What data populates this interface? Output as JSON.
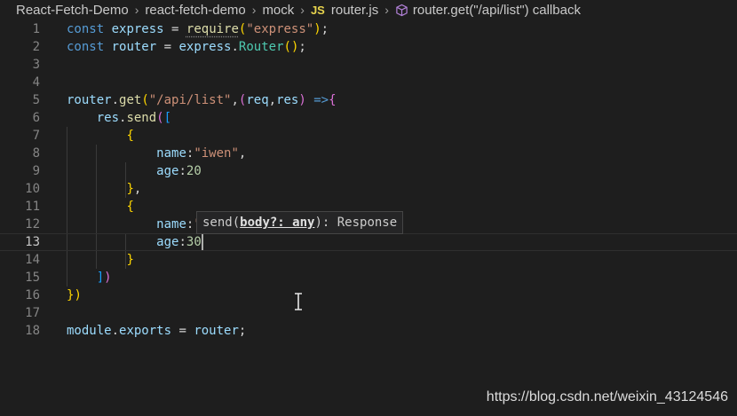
{
  "breadcrumbs": {
    "items": [
      "React-Fetch-Demo",
      "react-fetch-demo",
      "mock"
    ],
    "file_badge": "JS",
    "file_name": "router.js",
    "symbol": "router.get(\"/api/list\") callback"
  },
  "editor": {
    "active_line": 13,
    "line_numbers": [
      "1",
      "2",
      "3",
      "4",
      "5",
      "6",
      "7",
      "8",
      "9",
      "10",
      "11",
      "12",
      "13",
      "14",
      "15",
      "16",
      "17",
      "18"
    ],
    "lines": [
      [
        [
          "kw",
          "const"
        ],
        [
          "pun",
          " "
        ],
        [
          "var",
          "express"
        ],
        [
          "pun",
          " = "
        ],
        [
          "fn req",
          "require"
        ],
        [
          "br1",
          "("
        ],
        [
          "str",
          "\"express\""
        ],
        [
          "br1",
          ")"
        ],
        [
          "pun",
          ";"
        ]
      ],
      [
        [
          "kw",
          "const"
        ],
        [
          "pun",
          " "
        ],
        [
          "var",
          "router"
        ],
        [
          "pun",
          " = "
        ],
        [
          "var",
          "express"
        ],
        [
          "pun",
          "."
        ],
        [
          "cls",
          "Router"
        ],
        [
          "br1",
          "("
        ],
        [
          "br1",
          ")"
        ],
        [
          "pun",
          ";"
        ]
      ],
      [],
      [],
      [
        [
          "var",
          "router"
        ],
        [
          "pun",
          "."
        ],
        [
          "fn",
          "get"
        ],
        [
          "br1",
          "("
        ],
        [
          "str",
          "\"/api/list\""
        ],
        [
          "pun",
          ","
        ],
        [
          "br2",
          "("
        ],
        [
          "var",
          "req"
        ],
        [
          "pun",
          ","
        ],
        [
          "var",
          "res"
        ],
        [
          "br2",
          ")"
        ],
        [
          "pun",
          " "
        ],
        [
          "kw",
          "=>"
        ],
        [
          "br2",
          "{"
        ]
      ],
      [
        [
          "pun",
          "    "
        ],
        [
          "var",
          "res"
        ],
        [
          "pun",
          "."
        ],
        [
          "fn",
          "send"
        ],
        [
          "br2",
          "("
        ],
        [
          "br3",
          "["
        ]
      ],
      [
        [
          "pun",
          "        "
        ],
        [
          "br1",
          "{"
        ]
      ],
      [
        [
          "pun",
          "            "
        ],
        [
          "var",
          "name"
        ],
        [
          "pun",
          ":"
        ],
        [
          "str",
          "\"iwen\""
        ],
        [
          "pun",
          ","
        ]
      ],
      [
        [
          "pun",
          "            "
        ],
        [
          "var",
          "age"
        ],
        [
          "pun",
          ":"
        ],
        [
          "num",
          "20"
        ]
      ],
      [
        [
          "pun",
          "        "
        ],
        [
          "br1",
          "}"
        ],
        [
          "pun",
          ","
        ]
      ],
      [
        [
          "pun",
          "        "
        ],
        [
          "br1",
          "{"
        ]
      ],
      [
        [
          "pun",
          "            "
        ],
        [
          "var",
          "name"
        ],
        [
          "pun",
          ":"
        ],
        [
          "str",
          "\""
        ]
      ],
      [
        [
          "pun",
          "            "
        ],
        [
          "var",
          "age"
        ],
        [
          "pun",
          ":"
        ],
        [
          "num",
          "30"
        ]
      ],
      [
        [
          "pun",
          "        "
        ],
        [
          "br1",
          "}"
        ]
      ],
      [
        [
          "pun",
          "    "
        ],
        [
          "br3",
          "]"
        ],
        [
          "br2",
          ")"
        ]
      ],
      [
        [
          "br1",
          "}"
        ],
        [
          "br1",
          ")"
        ]
      ],
      [],
      [
        [
          "var",
          "module"
        ],
        [
          "pun",
          "."
        ],
        [
          "var",
          "exports"
        ],
        [
          "pun",
          " = "
        ],
        [
          "var",
          "router"
        ],
        [
          "pun",
          ";"
        ]
      ]
    ]
  },
  "tooltip": {
    "prefix": "send(",
    "param": "body?: any",
    "suffix": "): Response"
  },
  "watermark": "https://blog.csdn.net/weixin_43124546",
  "colors": {
    "background": "#1e1e1e",
    "keyword": "#569cd6",
    "string": "#ce9178",
    "function": "#dcdcaa",
    "variable": "#9cdcfe"
  }
}
